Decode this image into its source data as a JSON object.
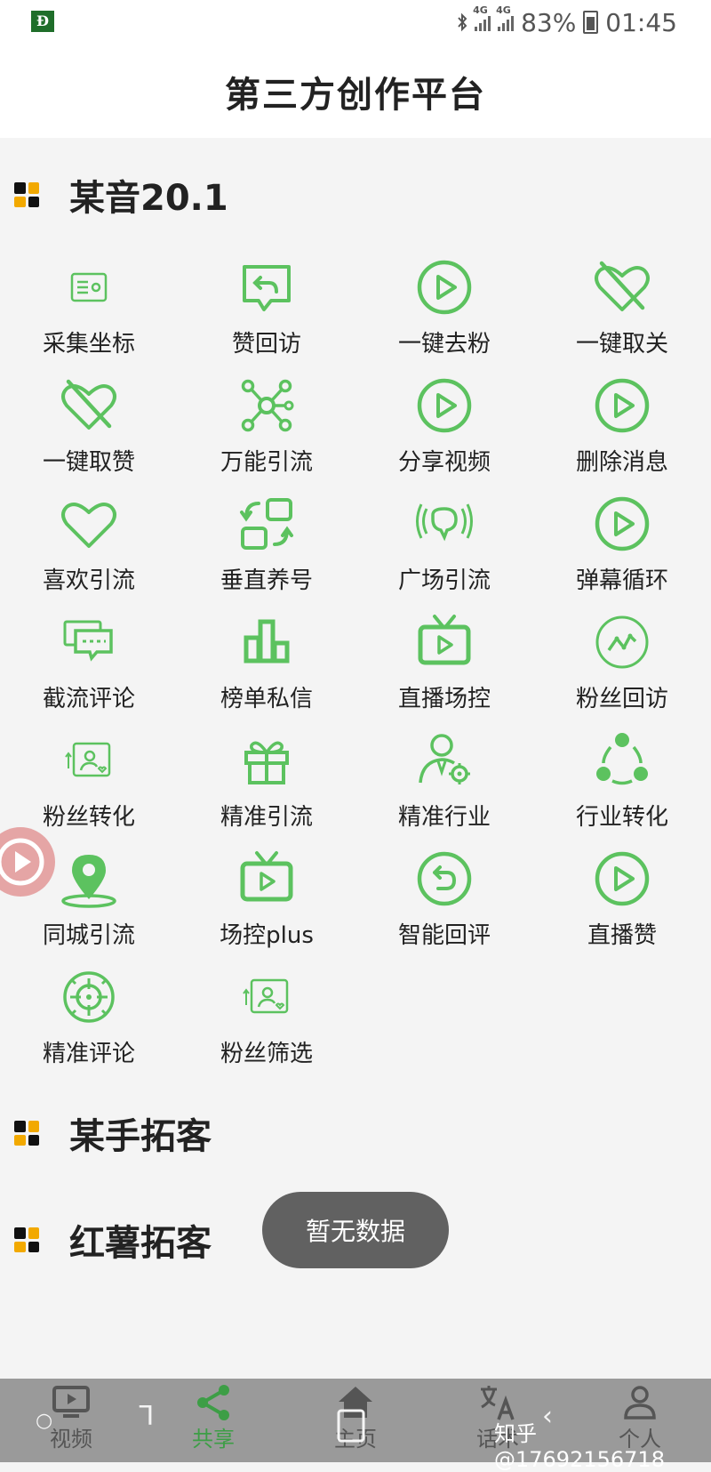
{
  "status_bar": {
    "battery": "83%",
    "time": "01:45",
    "network": "4G",
    "network2": "4G"
  },
  "header": {
    "title": "第三方创作平台"
  },
  "section1": {
    "title": "某音20.1"
  },
  "features": [
    {
      "label": "采集坐标",
      "icon": "id-card-icon"
    },
    {
      "label": "赞回访",
      "icon": "reply-chat-icon"
    },
    {
      "label": "一键去粉",
      "icon": "play-circle-icon"
    },
    {
      "label": "一键取关",
      "icon": "heart-off-icon"
    },
    {
      "label": "一键取赞",
      "icon": "heart-off-icon"
    },
    {
      "label": "万能引流",
      "icon": "network-hub-icon"
    },
    {
      "label": "分享视频",
      "icon": "play-circle-icon"
    },
    {
      "label": "删除消息",
      "icon": "play-circle-icon"
    },
    {
      "label": "喜欢引流",
      "icon": "heart-icon"
    },
    {
      "label": "垂直养号",
      "icon": "swap-squares-icon"
    },
    {
      "label": "广场引流",
      "icon": "broadcast-bubble-icon"
    },
    {
      "label": "弹幕循环",
      "icon": "play-circle-icon"
    },
    {
      "label": "截流评论",
      "icon": "comments-icon"
    },
    {
      "label": "榜单私信",
      "icon": "bar-chart-icon"
    },
    {
      "label": "直播场控",
      "icon": "tv-play-icon"
    },
    {
      "label": "粉丝回访",
      "icon": "trend-circle-icon"
    },
    {
      "label": "粉丝转化",
      "icon": "user-card-icon"
    },
    {
      "label": "精准引流",
      "icon": "gift-icon"
    },
    {
      "label": "精准行业",
      "icon": "user-gear-icon"
    },
    {
      "label": "行业转化",
      "icon": "cycle-dots-icon"
    },
    {
      "label": "同城引流",
      "icon": "location-pin-icon"
    },
    {
      "label": "场控plus",
      "icon": "tv-play-icon"
    },
    {
      "label": "智能回评",
      "icon": "undo-circle-icon"
    },
    {
      "label": "直播赞",
      "icon": "play-circle-icon"
    },
    {
      "label": "精准评论",
      "icon": "target-icon"
    },
    {
      "label": "粉丝筛选",
      "icon": "user-card-icon"
    }
  ],
  "section2": {
    "title": "某手拓客"
  },
  "section3": {
    "title": "红薯拓客"
  },
  "toast": {
    "text": "暂无数据"
  },
  "nav": [
    {
      "label": "视频",
      "icon": "tv-icon"
    },
    {
      "label": "共享",
      "icon": "share-icon"
    },
    {
      "label": "主页",
      "icon": "home-icon"
    },
    {
      "label": "话术",
      "icon": "translate-icon"
    },
    {
      "label": "个人",
      "icon": "person-icon"
    }
  ],
  "watermark": {
    "text": "知乎 @17692156718"
  },
  "colors": {
    "accent": "#5cc25f",
    "nav_active": "#3d9e46",
    "bg": "#f4f4f4",
    "toast": "#616161"
  }
}
